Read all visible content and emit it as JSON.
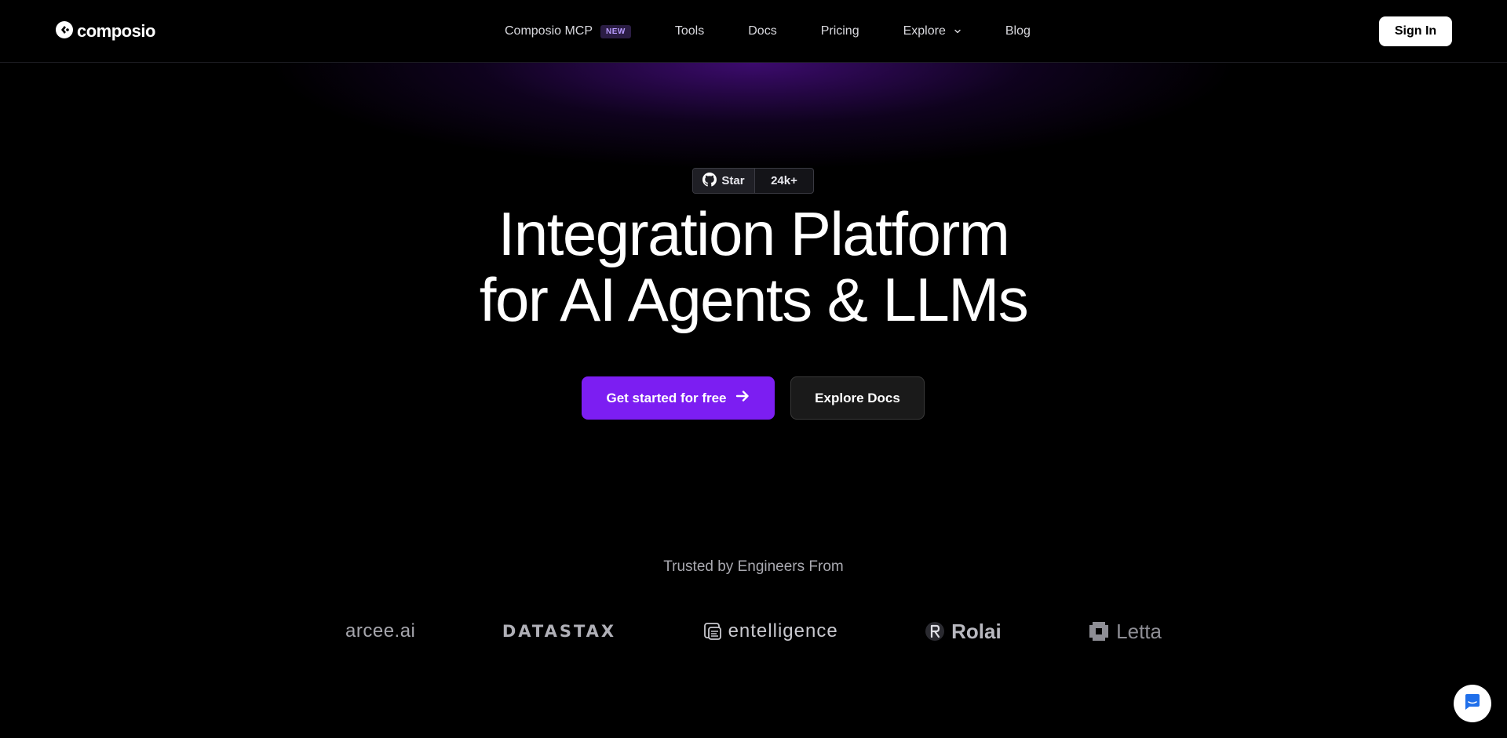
{
  "brand": {
    "name": "composio",
    "logo_icon": "composio-logo-icon"
  },
  "nav": {
    "items": [
      {
        "label": "Composio MCP",
        "badge": "NEW"
      },
      {
        "label": "Tools"
      },
      {
        "label": "Docs"
      },
      {
        "label": "Pricing"
      },
      {
        "label": "Explore",
        "icon": "chevron-down-icon"
      },
      {
        "label": "Blog"
      }
    ],
    "sign_in": "Sign In"
  },
  "github": {
    "star_label": "Star",
    "star_count": "24k+",
    "icon": "github-icon"
  },
  "hero": {
    "headline_line1": "Integration Platform",
    "headline_line2": "for AI Agents & LLMs",
    "primary_cta": "Get started for free",
    "primary_cta_icon": "arrow-right-icon",
    "secondary_cta": "Explore Docs"
  },
  "trusted": {
    "heading": "Trusted by Engineers From",
    "logos": [
      "arcee.ai",
      "DATASTAX",
      "entelligence",
      "Rolai",
      "Letta"
    ]
  },
  "colors": {
    "background": "#000000",
    "accent": "#7c1ef2",
    "glow": "#6e14c8",
    "badge_bg": "#2b1d44",
    "badge_text": "#b99cff",
    "chat_icon": "#1f6fea"
  },
  "chat": {
    "icon": "chat-bubble-icon"
  }
}
